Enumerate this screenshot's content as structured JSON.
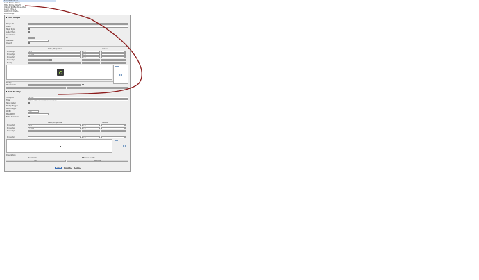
{
  "context_menu": {
    "items": [
      {
        "label": "Select Identical"
      },
      {
        "label": "Lock  Shift+Ctrl+L"
      },
      {
        "label": "Hide  Shift+Ctrl+H"
      },
      {
        "label": "Unlock  Shift+Ctrl+Alt+L"
      },
      {
        "label": "Layer  Ctrl+G"
      },
      {
        "label": "Add / Edit Data..."
      },
      {
        "label": "Edit Tooltip"
      }
    ]
  },
  "dialog": {
    "section1": {
      "header": "Edit Shape",
      "fields": [
        {
          "label": "Shape ID",
          "value": "Shape"
        },
        {
          "label": "Label",
          "value": ""
        },
        {
          "label": "Style Style",
          "value": ""
        },
        {
          "label": "Label Style"
        },
        {
          "label": "Line Colors"
        },
        {
          "label": "Fill"
        },
        {
          "label": "Gradient"
        },
        {
          "label": "Opacity"
        }
      ],
      "col_header_left": "Data / Properties",
      "col_header_right": "Values",
      "props": [
        {
          "name": "Property1",
          "value": "Text A",
          "type": "Text"
        },
        {
          "name": "Property2",
          "value": "1.0000",
          "type": "Text"
        },
        {
          "name": "Property3",
          "value": "",
          "type": "Text"
        },
        {
          "name": "Property4",
          "value": "",
          "type": "Text"
        },
        {
          "name": "Tooltip",
          "value": "",
          "type": ""
        }
      ],
      "bottom_label1": "Tooltip",
      "bottom_label2": "Placeholder",
      "bottom_value": "Text",
      "button_left": "Properties",
      "button_right": "Edit Data..."
    },
    "section2": {
      "header": "Edit Tooltip",
      "fields": [
        {
          "label": "Tooltip ID",
          "value": "Tooltip"
        },
        {
          "label": "Title",
          "value": "Shape with a tooltip that shows data"
        },
        {
          "label": "Show Label"
        },
        {
          "label": "Tooltip Trigger"
        },
        {
          "label": "Auto Height"
        },
        {
          "label": "Width",
          "value": "120"
        },
        {
          "label": "Max Width"
        },
        {
          "label": "Extra Template"
        }
      ],
      "col_header_left": "Data / Properties",
      "col_header_right": "Values",
      "props": [
        {
          "name": "Property1",
          "value": "Text A",
          "type": "Text"
        },
        {
          "name": "Property2",
          "value": "1.0000",
          "type": "Text"
        },
        {
          "name": "Property3",
          "value": "",
          "type": "Text"
        },
        {
          "name": "Property4",
          "value": "",
          "type": "Text"
        }
      ],
      "bottom_label": "Description",
      "bottom_value": "Placeholder",
      "check_label": "Use in tooltip",
      "button_left": "Add",
      "button_right": "Remove"
    },
    "footer": {
      "ok": "OK",
      "cancel": "Cancel",
      "help": "Help"
    }
  },
  "colors": {
    "annotation": "#8b1a1a",
    "dialog_bg": "#eeeeee",
    "highlight": "#cfe0f5"
  }
}
